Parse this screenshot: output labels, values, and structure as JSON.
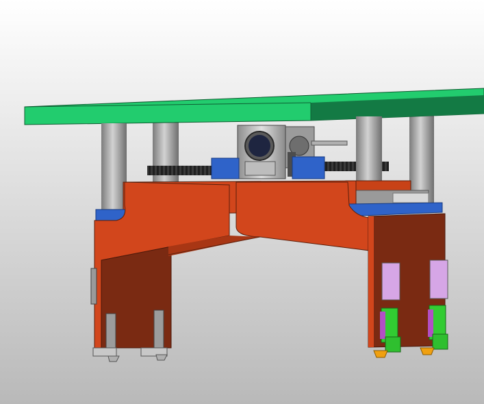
{
  "colors": {
    "background_top": "#ffffff",
    "background_bottom": "#b9b9b9",
    "plate_light": "#22cc6e",
    "plate_dark": "#137a44",
    "frame_orange": "#d2461c",
    "frame_dark": "#7a2a12",
    "mount_blue": "#2f63c9",
    "column_gray": "#9a9a9a",
    "cylinder_violet": "#d6a6e6",
    "valve_green": "#32cc32",
    "accent_gold": "#f0a010"
  },
  "parts": {
    "top_plate": "green-mounting-plate",
    "gearbox": "gear-motor-icon",
    "lead_screw": "lead-screw-icon",
    "linear_guides": "guide-column-icon",
    "gantry_frame": "orange-gantry-frame",
    "left_grippers": "gray-gripper-icon",
    "right_grippers": "pneumatic-gripper-icon"
  }
}
